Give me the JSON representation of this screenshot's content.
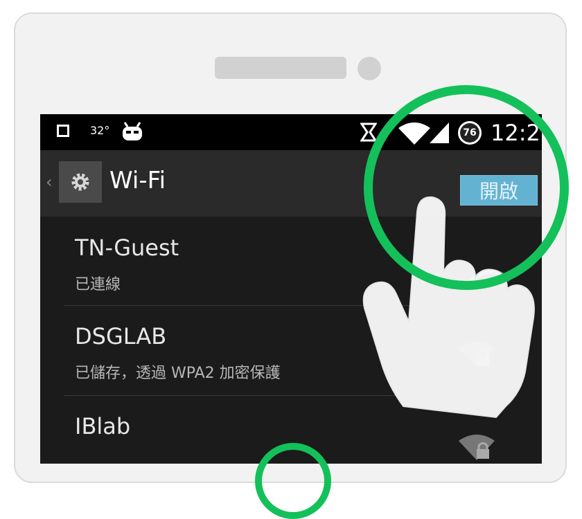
{
  "status_bar": {
    "temperature": "32°",
    "battery_level": "76",
    "clock": "12:2"
  },
  "action_bar": {
    "back_glyph": "‹",
    "title": "Wi-Fi",
    "toggle_label": "開啟",
    "icon": "gear-icon"
  },
  "networks": [
    {
      "name": "TN-Guest",
      "status": "已連線",
      "icon": "wifi-signal-icon"
    },
    {
      "name": "DSGLAB",
      "status": "已儲存，透過 WPA2 加密保護",
      "icon": "wifi-lock-icon"
    },
    {
      "name": "IBlab",
      "status": "",
      "icon": "wifi-lock-icon"
    }
  ],
  "colors": {
    "highlight_ring": "#13c05a",
    "toggle_on": "#63b2d2"
  }
}
